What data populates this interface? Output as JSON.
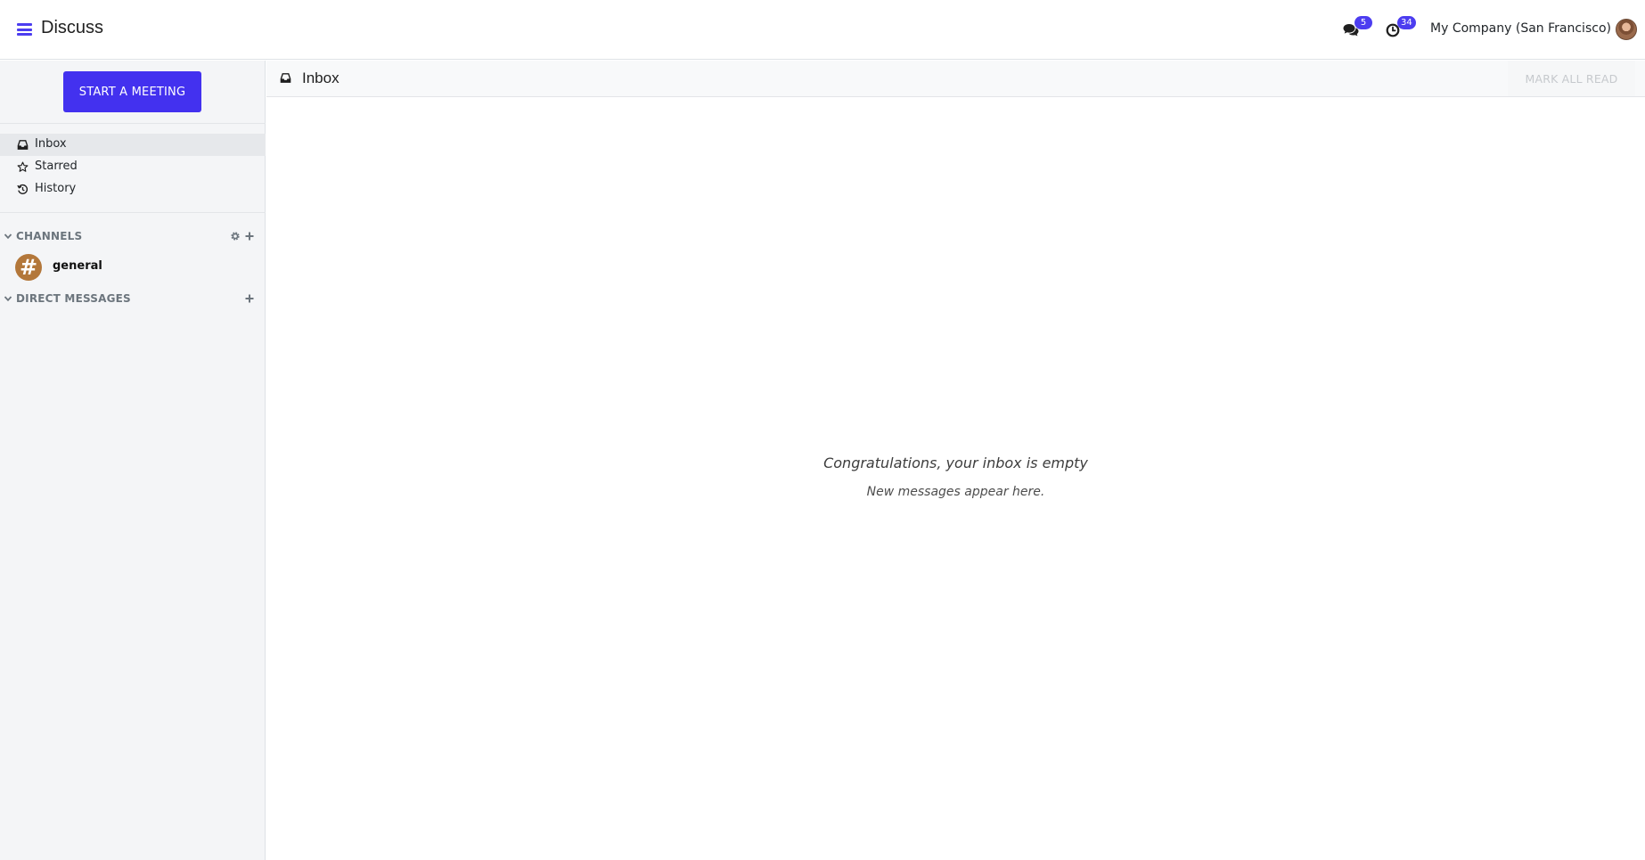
{
  "navbar": {
    "app_title": "Discuss",
    "messages_badge": "5",
    "activities_badge": "34",
    "company_name": "My Company (San Francisco)",
    "accent_color": "#4c3df0"
  },
  "sidebar": {
    "start_meeting_label": "START A MEETING",
    "mailboxes": [
      {
        "label": "Inbox",
        "icon": "inbox-icon",
        "active": true
      },
      {
        "label": "Starred",
        "icon": "star-icon",
        "active": false
      },
      {
        "label": "History",
        "icon": "history-icon",
        "active": false
      }
    ],
    "categories": {
      "channels": {
        "label": "CHANNELS",
        "items": [
          {
            "name": "general",
            "avatar_glyph": "#",
            "avatar_color": "#b3773a"
          }
        ]
      },
      "direct_messages": {
        "label": "DIRECT MESSAGES"
      }
    }
  },
  "main": {
    "thread_title": "Inbox",
    "mark_all_read_label": "MARK ALL READ",
    "empty_title": "Congratulations, your inbox is empty",
    "empty_subtitle": "New messages appear here."
  }
}
